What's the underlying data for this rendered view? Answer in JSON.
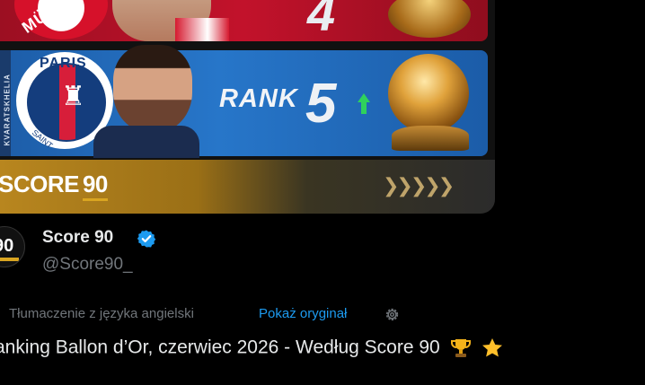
{
  "card": {
    "top_rank_number": "4",
    "top_club_text": "MÜ",
    "side_label": "KVARATSKHELIA",
    "psg_text": "PARIS",
    "psg_subtext": "SAINT",
    "rank_label": "RANK",
    "rank_value": "5",
    "rank_trend": "up",
    "footer_brand": "SCORE",
    "footer_brand_number": "90"
  },
  "avatar": {
    "text": "90"
  },
  "author": {
    "name": "Score 90",
    "handle": "@Score90_",
    "verified": true
  },
  "translation": {
    "note": "Tłumaczenie z języka angielski",
    "show_original": "Pokaż oryginał",
    "settings_icon": "gear-icon"
  },
  "tweet": {
    "text": "anking Ballon d’Or, czerwiec 2026 - Według Score 90",
    "emojis": [
      "trophy-icon",
      "star-icon"
    ]
  },
  "colors": {
    "background": "#000000",
    "link": "#1d9bf0",
    "muted": "#71767b",
    "verified": "#1d9bf0",
    "rank_up": "#2fd15c",
    "gold": "#d9a521"
  }
}
